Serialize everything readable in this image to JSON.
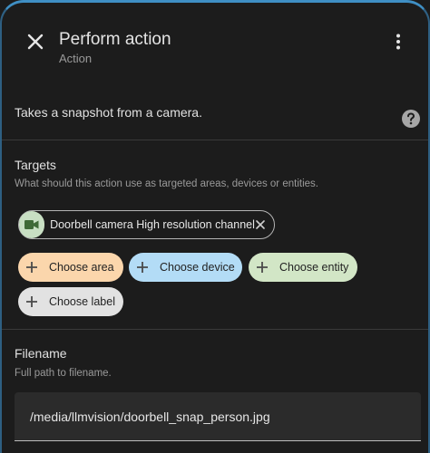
{
  "header": {
    "title": "Perform action",
    "subtitle": "Action",
    "close_icon": "close-icon",
    "menu_icon": "more-vertical-icon"
  },
  "description": {
    "text": "Takes a snapshot from a camera.",
    "help_icon": "help-circle-icon"
  },
  "targets": {
    "title": "Targets",
    "helper": "What should this action use as targeted areas, devices or entities.",
    "selected": [
      {
        "label": "Doorbell camera High resolution channel",
        "icon": "video-camera-icon",
        "color": "#c8dfc3"
      }
    ],
    "choose_buttons": [
      {
        "label": "Choose area",
        "color": "#fbd6ac"
      },
      {
        "label": "Choose device",
        "color": "#b3dcf6"
      },
      {
        "label": "Choose entity",
        "color": "#d2e6c6"
      },
      {
        "label": "Choose label",
        "color": "#e2e2e2"
      }
    ]
  },
  "filename": {
    "title": "Filename",
    "helper": "Full path to filename.",
    "value": "/media/llmvision/doorbell_snap_person.jpg"
  },
  "colors": {
    "background": "#1c1c1c",
    "accent_border": "#3f8fc4",
    "input_bg": "#2b2b2b"
  }
}
